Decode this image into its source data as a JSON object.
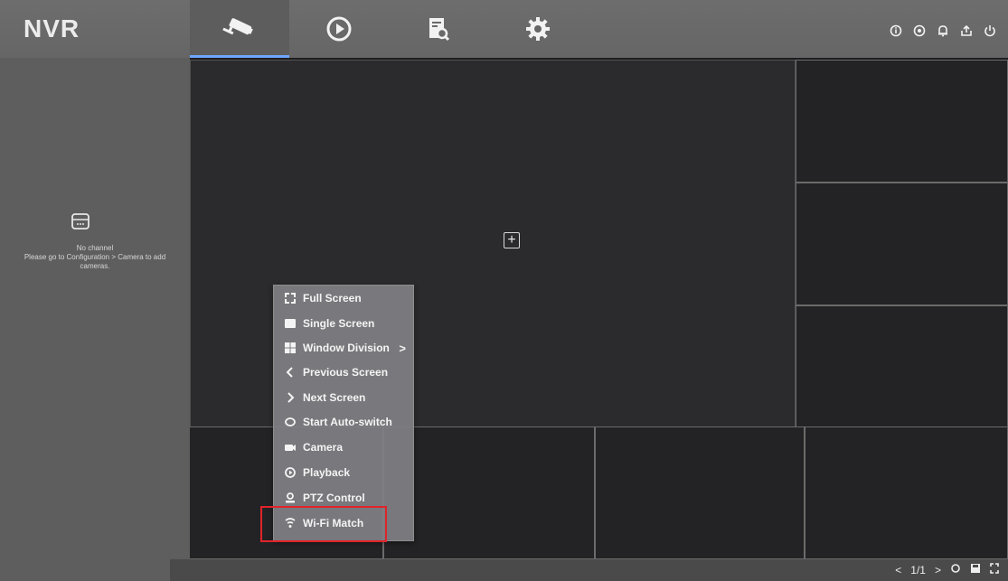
{
  "app": {
    "logo": "NVR"
  },
  "tabs": [
    {
      "icon": "camera-icon"
    },
    {
      "icon": "playback-icon"
    },
    {
      "icon": "search-icon"
    },
    {
      "icon": "gear-icon"
    }
  ],
  "top_icons": [
    "info-icon",
    "record-icon",
    "bell-icon",
    "export-icon",
    "power-icon"
  ],
  "left_panel": {
    "line1": "No channel",
    "line2": "Please go to Configuration > Camera to add",
    "line3": "cameras."
  },
  "context_menu": [
    {
      "label": "Full Screen",
      "icon": "fullscreen-icon"
    },
    {
      "label": "Single Screen",
      "icon": "single-screen-icon"
    },
    {
      "label": "Window Division",
      "icon": "grid-icon",
      "arrow": ">"
    },
    {
      "label": "Previous Screen",
      "icon": "previous-icon"
    },
    {
      "label": "Next Screen",
      "icon": "next-icon"
    },
    {
      "label": "Start Auto-switch",
      "icon": "autoswitch-icon"
    },
    {
      "label": "Camera",
      "icon": "camera-icon"
    },
    {
      "label": "Playback",
      "icon": "playback-icon"
    },
    {
      "label": "PTZ Control",
      "icon": "ptz-icon"
    },
    {
      "label": "Wi-Fi Match",
      "icon": "wifi-match-icon"
    }
  ],
  "pager": {
    "prev": "<",
    "page": "1/1",
    "next": ">"
  },
  "colors": {
    "accent": "#6ea6ff",
    "highlight": "#e0242a"
  }
}
